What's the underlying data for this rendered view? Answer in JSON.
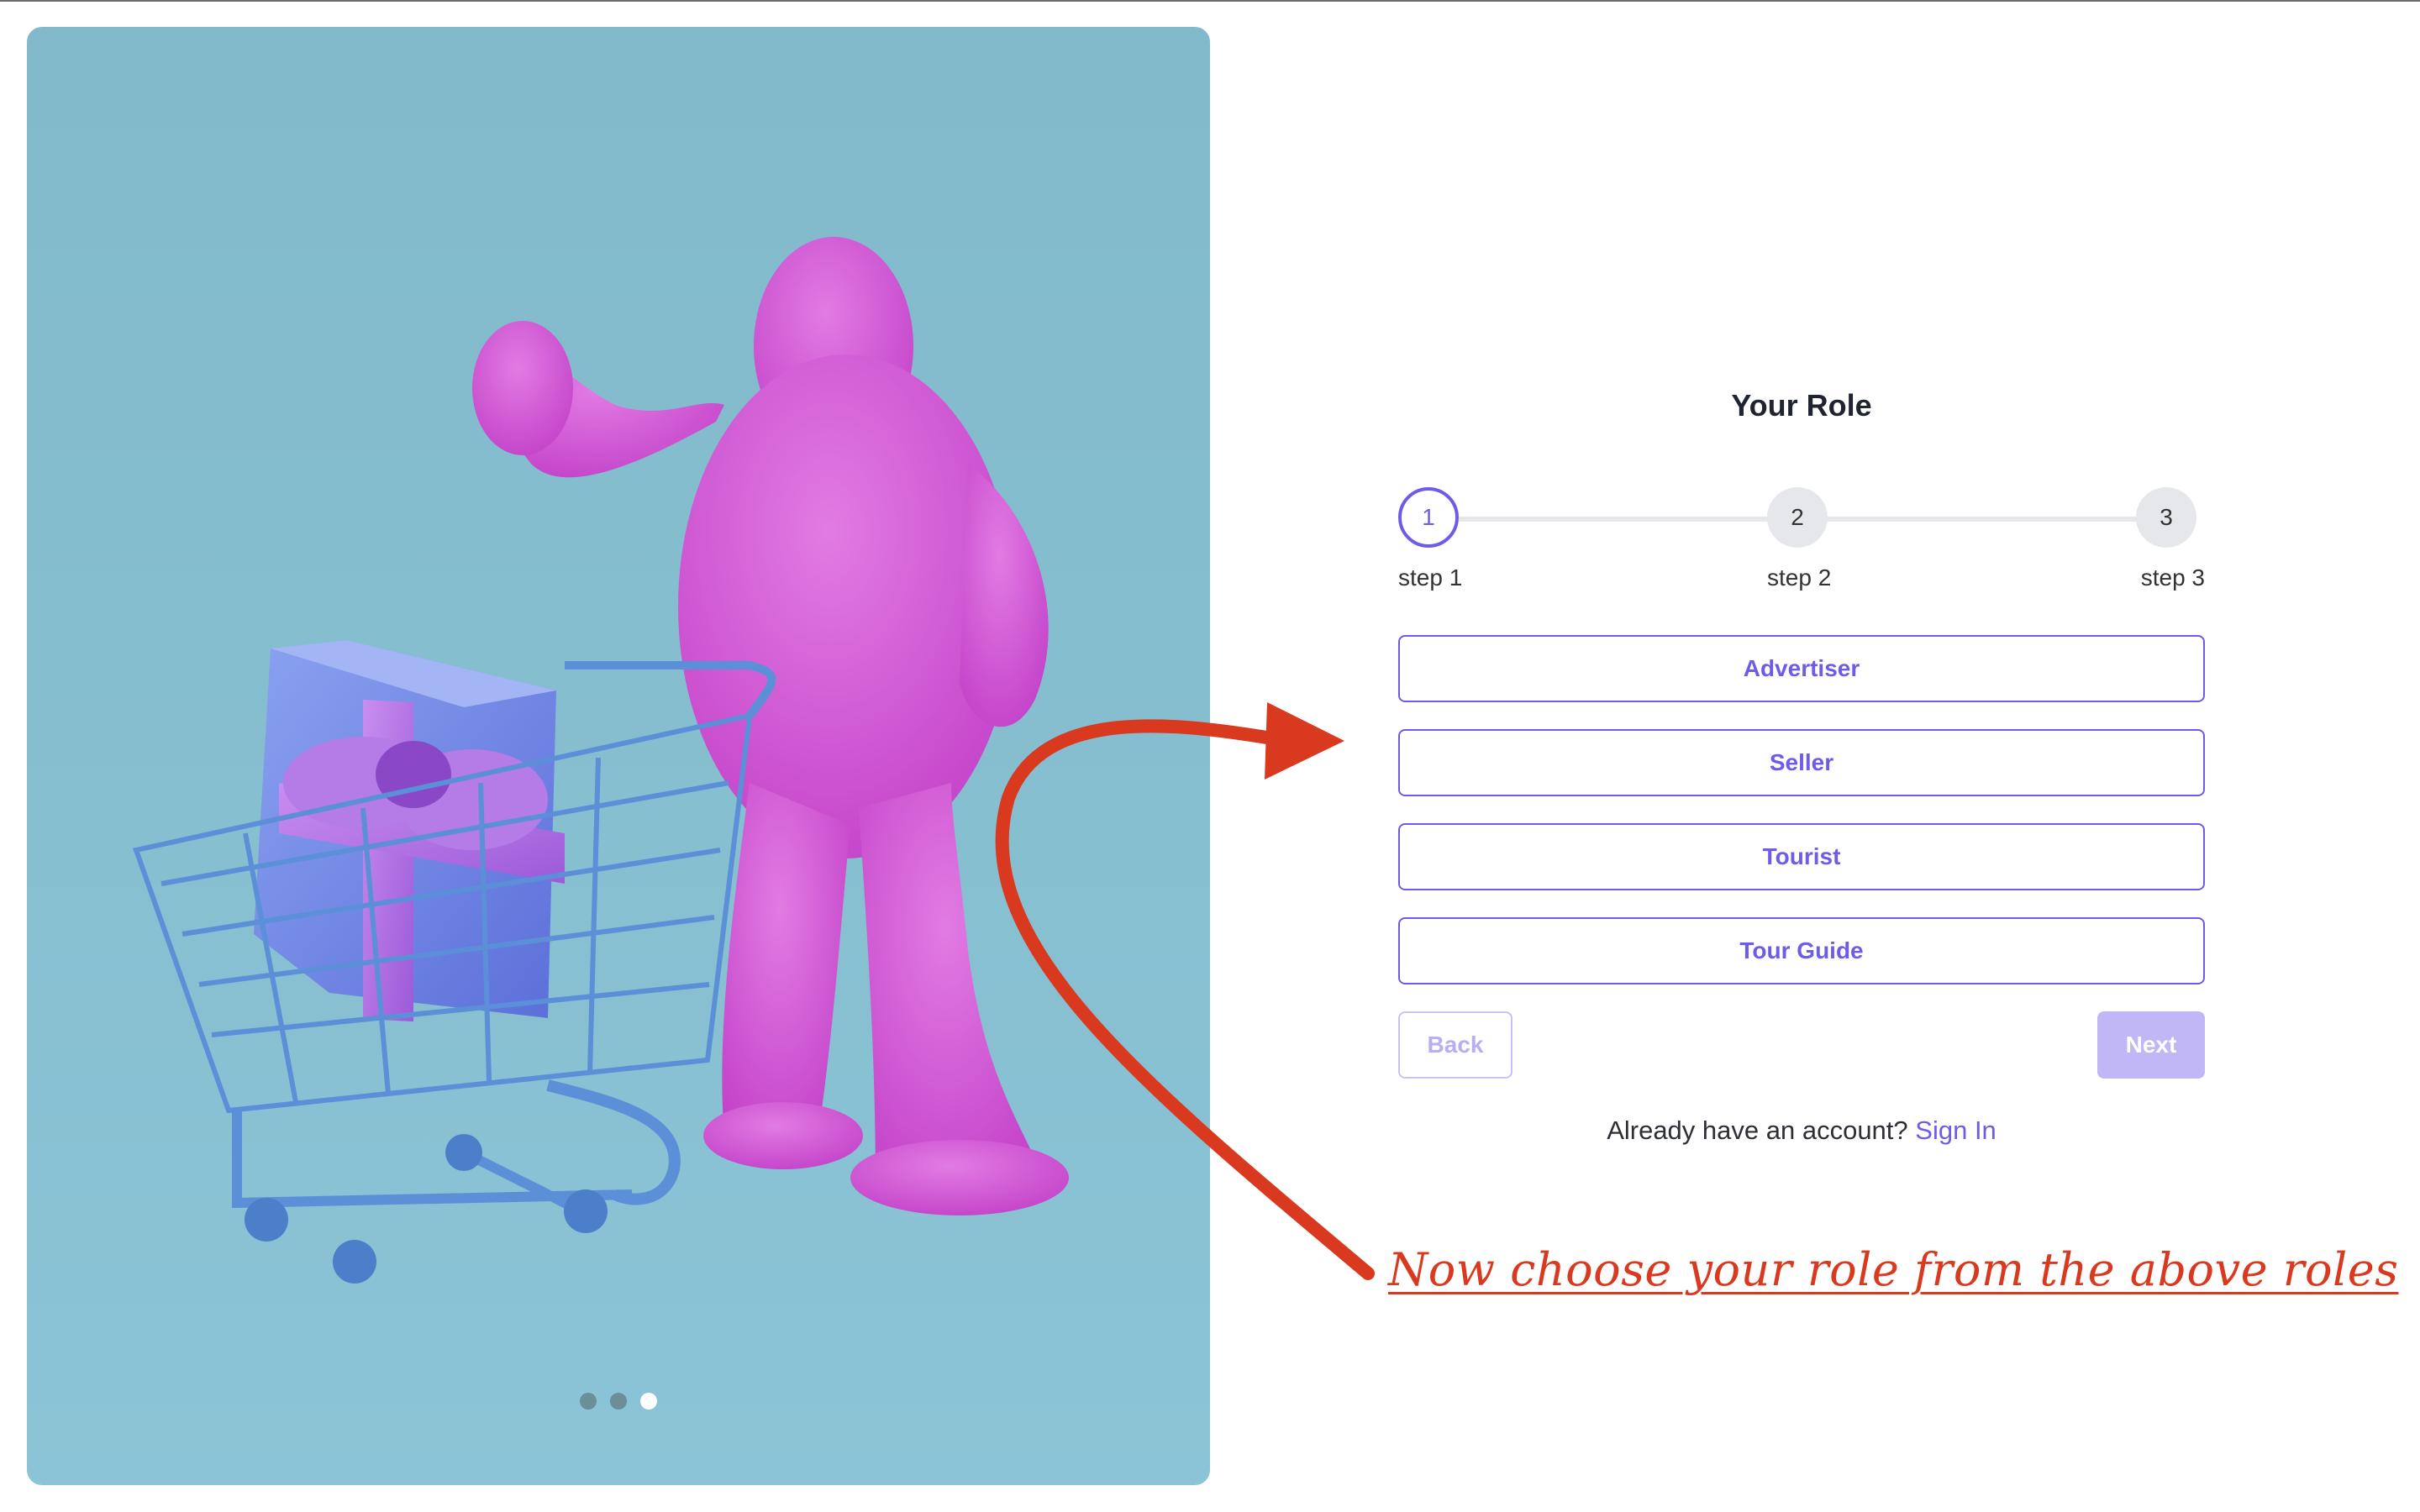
{
  "hero": {
    "illustration": "pink-furry-creature-with-shopping-cart-and-gift",
    "carousel": {
      "count": 3,
      "active": 3
    },
    "colors": {
      "background": "#86bfd0",
      "creature": "#d455d6",
      "gift": "#6b7fe0",
      "cart": "#5b8fd8"
    }
  },
  "form": {
    "title": "Your Role",
    "steps": [
      {
        "number": "1",
        "label": "step 1"
      },
      {
        "number": "2",
        "label": "step 2"
      },
      {
        "number": "3",
        "label": "step 3"
      }
    ],
    "current_step": 1,
    "roles": [
      "Advertiser",
      "Seller",
      "Tourist",
      "Tour Guide"
    ],
    "back_label": "Back",
    "next_label": "Next",
    "signin_prompt": "Already have an account?",
    "signin_link": "Sign In"
  },
  "annotation": {
    "text": "Now choose your role from the above roles",
    "color": "#d9391f",
    "icon": "curved-arrow-icon"
  },
  "colors": {
    "accent": "#6d5ce8",
    "accent_disabled": "#c1b6f6"
  }
}
